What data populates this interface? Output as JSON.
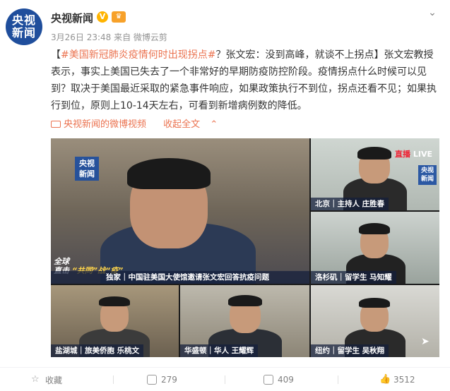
{
  "header": {
    "avatar_text_1": "央视",
    "avatar_text_2": "新闻",
    "name": "央视新闻",
    "meta": "3月26日 23:48 来自 微博云剪",
    "more_icon": "chevron-down-icon"
  },
  "post": {
    "bracket_open": "【",
    "hashtag": "#美国新冠肺炎疫情何时出现拐点#",
    "text_1": "？张文宏：没到高峰，就谈不上拐点】张文宏教授表示，事实上美国已失去了一个非常好的早期防疫防控阶段。疫情拐点什么时候可以见到？取决于美国最近采取的紧急事件响应，如果政策执行不到位，拐点还看不见；如果执行到位，原则上10-14天左右，可看到新增病例数的降低。",
    "video_link": "央视新闻的微博视频",
    "collapse_link": "收起全文",
    "collapse_icon": "chevron-up-icon"
  },
  "video": {
    "logo_1": "央视",
    "logo_2": "新闻",
    "main_caption": "独家｜中国驻美国大使馆邀请张文宏回答抗疫问题",
    "global_1": "全球",
    "global_2": "直击",
    "global_3": "“共同”战“疫”",
    "live_label": "直播",
    "live_suffix": "LIVE",
    "host_caption": "北京｜主持人 庄胜春",
    "la_caption": "洛杉矶｜留学生 马知耀",
    "slc_caption": "盐湖城｜旅美侨胞 乐桃文",
    "dc_caption": "华盛顿｜华人 王耀辉",
    "ny_caption": "纽约｜留学生 吴秋翔"
  },
  "footer": {
    "favorite_label": "收藏",
    "repost_count": "279",
    "comment_count": "409",
    "like_count": "3512"
  }
}
